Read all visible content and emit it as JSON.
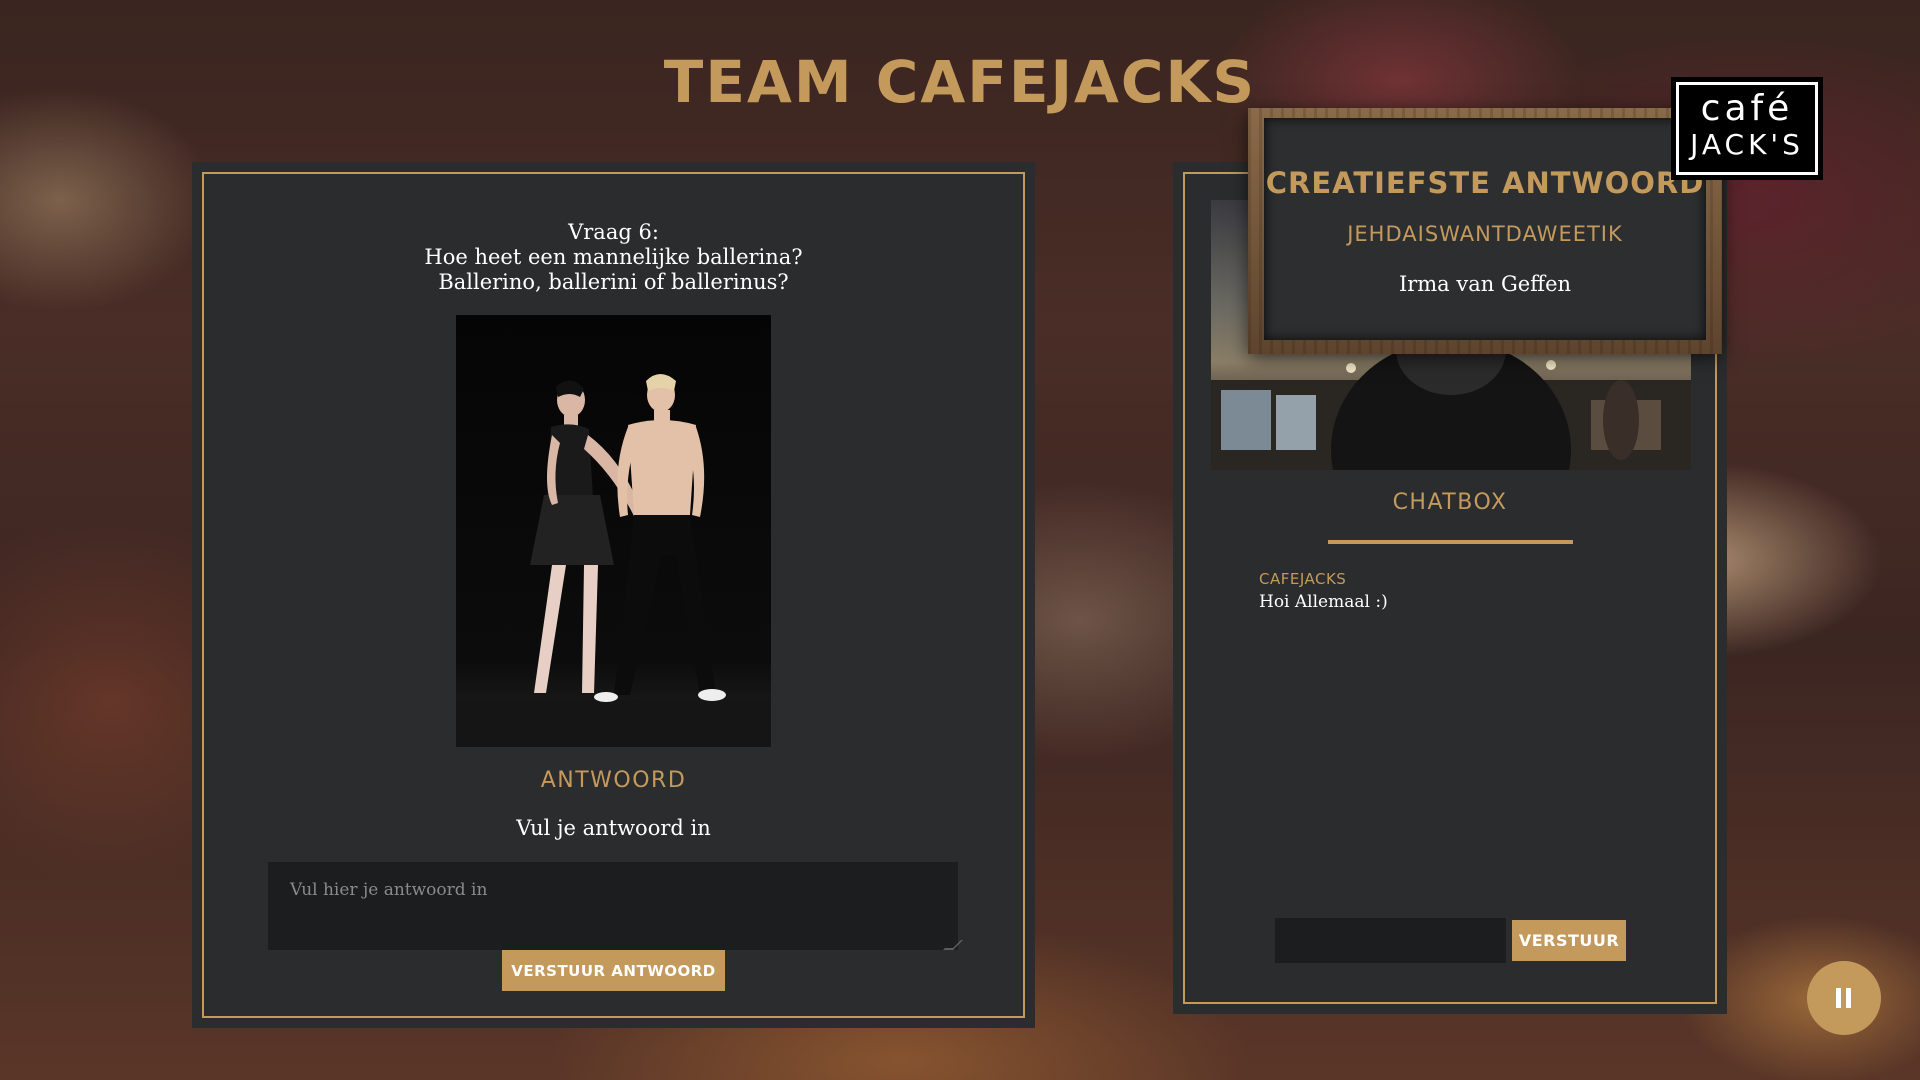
{
  "header": {
    "title": "TEAM CAFEJACKS"
  },
  "question": {
    "number": "Vraag 6:",
    "line1": "Hoe heet een mannelijke ballerina?",
    "line2": "Ballerino, ballerini of ballerinus?"
  },
  "answer": {
    "label": "ANTWOORD",
    "instruction": "Vul je antwoord in",
    "placeholder": "Vul hier je antwoord in",
    "submit_label": "VERSTUUR ANTWOORD"
  },
  "chat": {
    "title": "CHATBOX",
    "messages": [
      {
        "author": "CAFEJACKS",
        "text": "Hoi Allemaal :)"
      }
    ],
    "input_value": "",
    "send_label": "VERSTUUR"
  },
  "popup": {
    "title": "CREATIEFSTE ANTWOORD",
    "team": "JEHDAISWANTDAWEETIK",
    "name": "Irma van Geffen"
  },
  "logo": {
    "top": "café",
    "bottom": "JACK'S"
  },
  "controls": {
    "pause_icon": "pause-icon"
  },
  "colors": {
    "accent": "#c49a5c",
    "panel": "#2b2c2e",
    "input": "#1c1d1f"
  }
}
